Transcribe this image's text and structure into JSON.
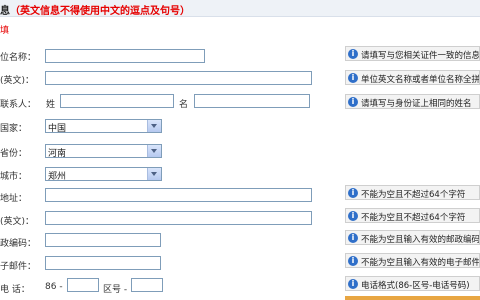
{
  "header": {
    "title": "息",
    "note": "（英文信息不得使用中文的逗点及句号）"
  },
  "required_mark": "填",
  "rows": {
    "company_name": {
      "label": "位名称：",
      "hint": "请填写与您相关证件一致的信息"
    },
    "company_name_en": {
      "label": "(英文)：",
      "hint": "单位英文名称或者单位名称全拼"
    },
    "contact": {
      "label": "联系人：",
      "surname_label": "姓",
      "given_label": "名",
      "hint": "请填写与身份证上相同的姓名"
    },
    "country": {
      "label": "国家：",
      "value": "中国"
    },
    "province": {
      "label": "省份：",
      "value": "河南"
    },
    "city": {
      "label": "城市：",
      "value": "郑州"
    },
    "address": {
      "label": "地址：",
      "hint": "不能为空且不超过64个字符"
    },
    "address_en": {
      "label": "(英文)：",
      "hint": "不能为空且不超过64个字符"
    },
    "postcode": {
      "label": "政编码：",
      "hint": "不能为空且输入有效的邮政编码"
    },
    "email": {
      "label": "子邮件：",
      "hint": "不能为空且输入有效的电子邮件"
    },
    "phone": {
      "label": "电  话：",
      "country_code": "86 -",
      "area_label": "区号 -",
      "hint": "电话格式(86-区号-电话号码)"
    }
  },
  "colors": {
    "accent_red": "#e60000",
    "hint_icon": "#2f6fc9",
    "border": "#7f9db9"
  },
  "icons": {
    "hint": "info-icon",
    "dropdown": "chevron-down-icon"
  }
}
